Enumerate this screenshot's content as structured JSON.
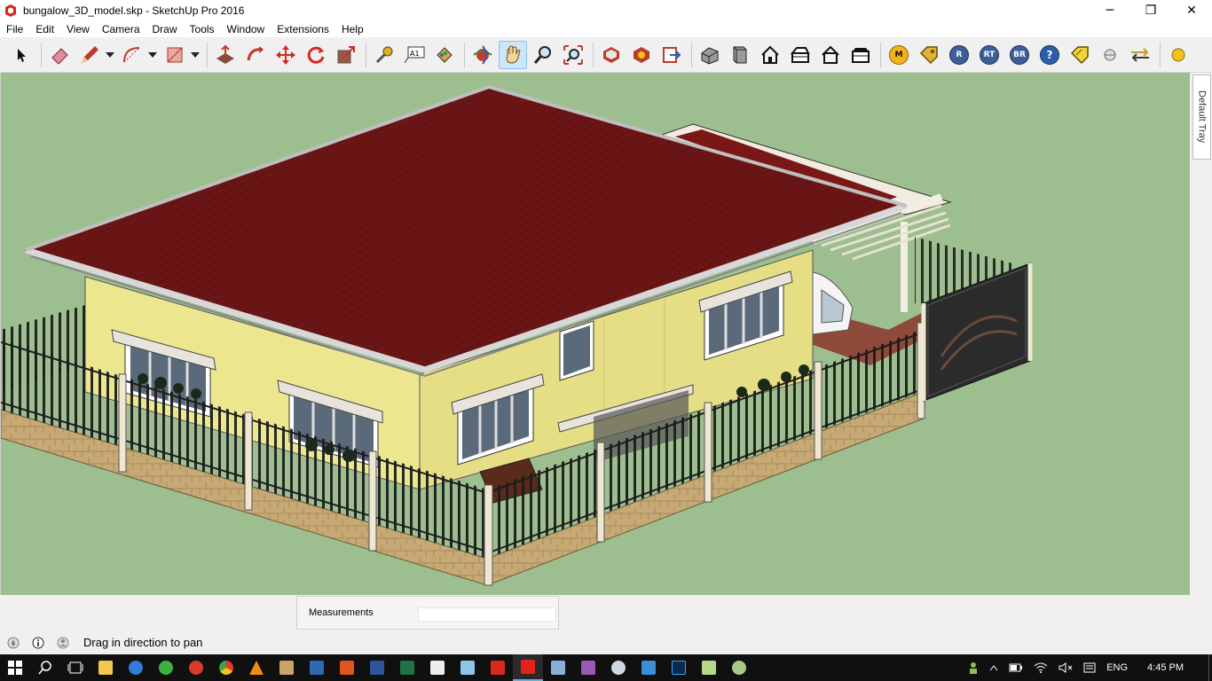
{
  "window": {
    "title": "bungalow_3D_model.skp - SketchUp Pro 2016",
    "controls": {
      "minimize": "─",
      "restore": "❐",
      "close": "✕"
    }
  },
  "menu": [
    "File",
    "Edit",
    "View",
    "Camera",
    "Draw",
    "Tools",
    "Window",
    "Extensions",
    "Help"
  ],
  "toolbar": {
    "ruby_buttons": [
      "M",
      "R",
      "RT",
      "BR"
    ],
    "help_button": "?",
    "text_tool_label": "A1",
    "active_tool": "pan-tool"
  },
  "tray": {
    "tab_label": "Default Tray"
  },
  "measurements": {
    "label": "Measurements",
    "value": ""
  },
  "status": {
    "hint": "Drag in direction to pan"
  },
  "taskbar": {
    "language": "ENG",
    "time": "4:45 PM"
  },
  "colors": {
    "viewport_bg": "#9dbe8f",
    "roof": "#6b1616",
    "wall": "#ece78f",
    "fence": "#1d1d1d",
    "stone": "#c6a975"
  }
}
